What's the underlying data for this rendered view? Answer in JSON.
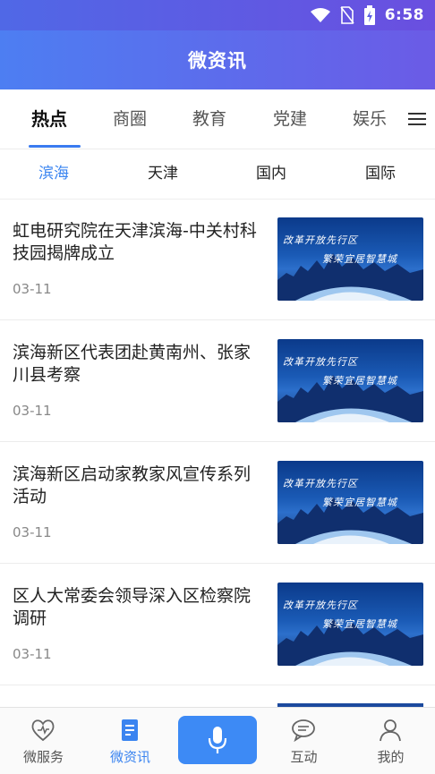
{
  "status_bar": {
    "time": "6:58",
    "icons": [
      "wifi-icon",
      "no-sim-icon",
      "battery-charging-icon"
    ]
  },
  "header": {
    "title": "微资讯"
  },
  "tabs": [
    {
      "label": "热点",
      "active": true
    },
    {
      "label": "商圈",
      "active": false
    },
    {
      "label": "教育",
      "active": false
    },
    {
      "label": "党建",
      "active": false
    },
    {
      "label": "娱乐",
      "active": false
    }
  ],
  "subtabs": [
    {
      "label": "滨海",
      "active": true
    },
    {
      "label": "天津",
      "active": false
    },
    {
      "label": "国内",
      "active": false
    },
    {
      "label": "国际",
      "active": false
    }
  ],
  "news": [
    {
      "title": "虹电研究院在天津滨海-中关村科技园揭牌成立",
      "date": "03-11"
    },
    {
      "title": "滨海新区代表团赴黄南州、张家川县考察",
      "date": "03-11"
    },
    {
      "title": "滨海新区启动家教家风宣传系列活动",
      "date": "03-11"
    },
    {
      "title": "区人大常委会领导深入区检察院调研",
      "date": "03-11"
    }
  ],
  "thumb_caption": {
    "line1": "改革开放先行区",
    "line2": "繁荣宜居智慧城"
  },
  "bottom_nav": [
    {
      "label": "微服务",
      "icon": "heart-icon",
      "active": false
    },
    {
      "label": "微资讯",
      "icon": "document-icon",
      "active": true
    },
    {
      "label": "",
      "icon": "microphone-icon",
      "active": false
    },
    {
      "label": "互动",
      "icon": "chat-icon",
      "active": false
    },
    {
      "label": "我的",
      "icon": "user-icon",
      "active": false
    }
  ],
  "colors": {
    "accent": "#3a84f0",
    "header_start": "#4d7ef2",
    "header_end": "#6b5be6"
  }
}
